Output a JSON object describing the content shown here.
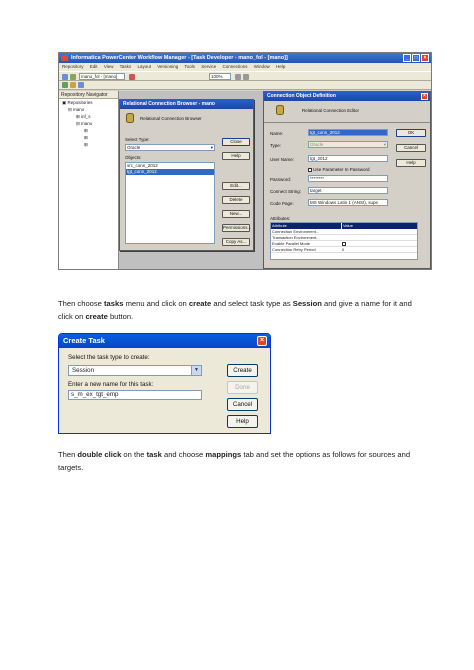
{
  "screenshot1": {
    "window_title": "Informatica PowerCenter Workflow Manager - [Task Developer - mano_fol - [mano]]",
    "menu": [
      "Repository",
      "Edit",
      "View",
      "Tasks",
      "Layout",
      "Versioning",
      "Tools",
      "Service",
      "Connections",
      "Window",
      "Help"
    ],
    "folder_combo": "mano_fol - [mano]",
    "zoom_combo": "100%",
    "repo_nav": {
      "header": "Repository Navigator",
      "items": [
        "Repositories",
        "mano",
        "inf_s",
        "mano"
      ]
    },
    "rel_conn_browser": {
      "title": "Relational Connection Browser - mano",
      "subtitle": "Relational Connection Browser",
      "select_type_label": "Select Type:",
      "select_type_value": "Oracle",
      "objects_label": "Objects:",
      "objects": [
        "src_conn_2012",
        "tgt_conn_2012"
      ],
      "buttons": [
        "Close",
        "Help",
        "Edit...",
        "Delete",
        "New...",
        "Permissions...",
        "Copy As..."
      ]
    },
    "conn_obj_def": {
      "title": "Connection Object Definition",
      "subtitle": "Relational Connection Editor",
      "name_label": "Name:",
      "name_value": "tgt_conn_2012",
      "type_label": "Type:",
      "type_value": "Oracle",
      "user_label": "User Name:",
      "user_value": "tgt_2012",
      "use_param_label": "Use Parameter In Password",
      "password_label": "Password:",
      "password_value": "********",
      "connect_label": "Connect String:",
      "connect_value": "target",
      "codepage_label": "Code Page:",
      "codepage_value": "MS Windows Latin 1 (ANSI), supe",
      "attributes_label": "Attributes:",
      "attr_headers": [
        "Attribute",
        "Value"
      ],
      "attrs": [
        "Connection Environment...",
        "Transaction Environment...",
        "Enable Parallel Mode",
        "Connection Retry Period"
      ],
      "retry_value": "0",
      "buttons": [
        "OK",
        "Cancel",
        "Help"
      ]
    }
  },
  "para1": {
    "t1": "Then choose ",
    "b1": "tasks",
    "t2": " menu and click on ",
    "b2": "create",
    "t3": " and select task type as ",
    "b3": "Session",
    "t4": " and give a name for it and click on ",
    "b4": "create",
    "t5": " button."
  },
  "create_task": {
    "title": "Create Task",
    "select_label": "Select the task type to create:",
    "type_value": "Session",
    "name_label": "Enter a new name for this task:",
    "name_value": "s_m_ex_tgt_emp",
    "buttons": {
      "create": "Create",
      "done": "Done",
      "cancel": "Cancel",
      "help": "Help"
    }
  },
  "para2": {
    "t1": "Then ",
    "b1": "double click",
    "t2": " on the ",
    "b2": "task",
    "t3": " and choose ",
    "b3": "mappings",
    "t4": " tab and set the options as follows for sources and targets."
  }
}
